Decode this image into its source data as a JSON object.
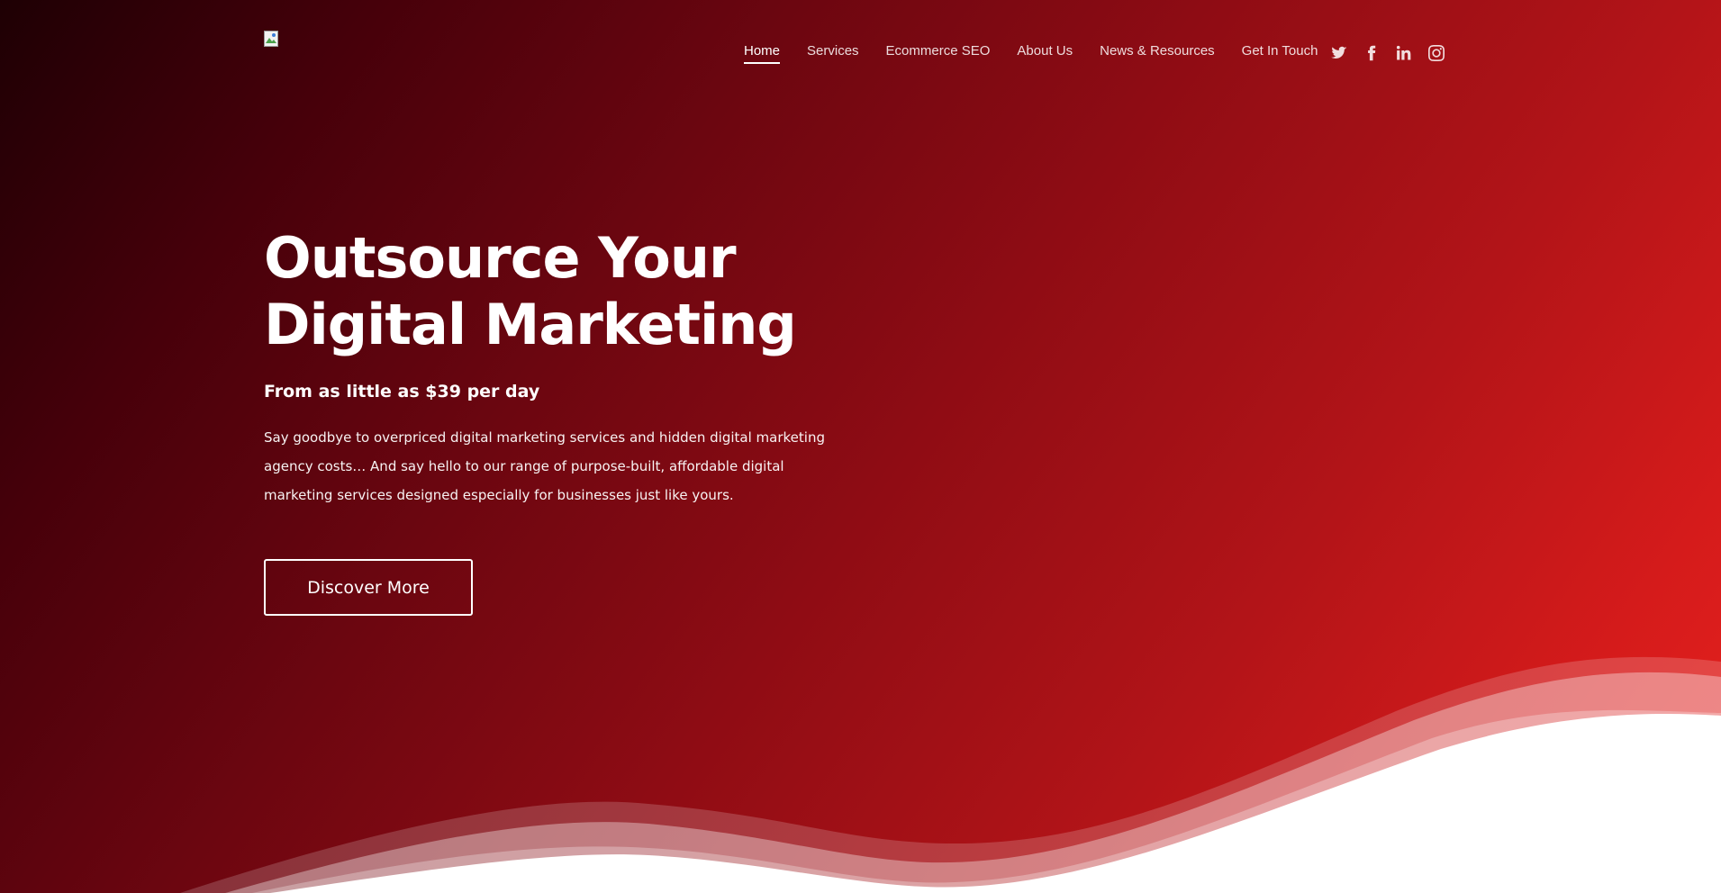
{
  "nav": {
    "items": [
      {
        "label": "Home",
        "active": true
      },
      {
        "label": "Services",
        "active": false
      },
      {
        "label": "Ecommerce SEO",
        "active": false
      },
      {
        "label": "About Us",
        "active": false
      },
      {
        "label": "News & Resources",
        "active": false
      },
      {
        "label": "Get In Touch",
        "active": false
      }
    ]
  },
  "social": {
    "icons": [
      "twitter-icon",
      "facebook-icon",
      "linkedin-icon",
      "instagram-icon"
    ]
  },
  "hero": {
    "title": "Outsource Your Digital Marketing",
    "subtitle": "From as little as $39 per day",
    "text": "Say goodbye to overpriced digital marketing services and hidden digital marketing agency costs… And say hello to our range of purpose-built, affordable digital marketing services designed especially for businesses just like yours.",
    "cta_label": "Discover More"
  },
  "colors": {
    "gradient_dark": "#1e0004",
    "gradient_mid": "#8f0c14",
    "gradient_bright": "#e8221e",
    "wave_light": "#f08a8a",
    "text": "#ffffff"
  }
}
